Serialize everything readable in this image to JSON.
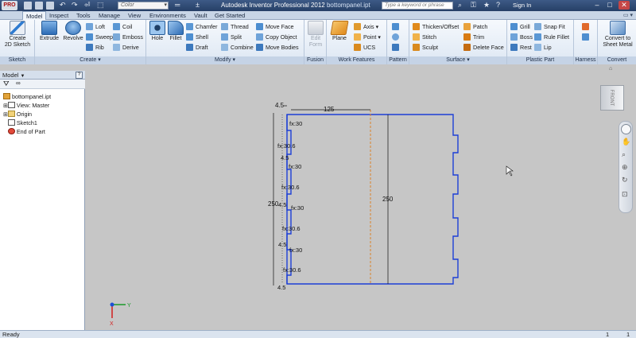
{
  "title_bar": {
    "app_button": "PRO",
    "color_combo": "Color",
    "app_name": "Autodesk Inventor Professional 2012",
    "document": "bottompanel.ipt",
    "search_placeholder": "Type a keyword or phrase",
    "sign_in": "Sign In"
  },
  "tabs": [
    "Model",
    "Inspect",
    "Tools",
    "Manage",
    "View",
    "Environments",
    "Vault",
    "Get Started"
  ],
  "ribbon": {
    "sketch_panel": {
      "label": "Sketch",
      "create_2d_sketch": "Create\n2D Sketch"
    },
    "create_panel": {
      "label": "Create",
      "extrude": "Extrude",
      "revolve": "Revolve",
      "small": [
        "Loft",
        "Sweep",
        "Rib",
        "Coil",
        "Emboss",
        "Derive"
      ]
    },
    "modify_panel": {
      "label": "Modify",
      "hole": "Hole",
      "fillet": "Fillet",
      "small": [
        "Chamfer",
        "Shell",
        "Draft",
        "Thread",
        "Split",
        "Combine",
        "Move Face",
        "Copy Object",
        "Move Bodies"
      ]
    },
    "fusion_panel": {
      "label": "Fusion",
      "edit_form": "Edit\nForm"
    },
    "work_features_panel": {
      "label": "Work Features",
      "plane": "Plane",
      "small": [
        "Axis",
        "Point",
        "UCS"
      ]
    },
    "pattern_panel": {
      "label": "Pattern"
    },
    "surface_panel": {
      "label": "Surface",
      "small": [
        "Thicken/Offset",
        "Stitch",
        "Sculpt",
        "Patch",
        "Trim",
        "Delete Face"
      ]
    },
    "plastic_part_panel": {
      "label": "Plastic Part",
      "small": [
        "Grill",
        "Boss",
        "Rest",
        "Snap Fit",
        "Rule Fillet",
        "Lip"
      ]
    },
    "harness_panel": {
      "label": "Harness"
    },
    "convert_panel": {
      "label": "Convert",
      "convert_to_sheet_metal": "Convert to\nSheet Metal"
    }
  },
  "browser": {
    "header": "Model",
    "items": [
      {
        "label": "bottompanel.ipt",
        "level": 0
      },
      {
        "label": "View: Master",
        "level": 1
      },
      {
        "label": "Origin",
        "level": 1
      },
      {
        "label": "Sketch1",
        "level": 1
      },
      {
        "label": "End of Part",
        "level": 1
      }
    ]
  },
  "sketch": {
    "dim_top_left": "4.5",
    "dim_top_width": "125",
    "dim_height_left": "250",
    "dim_height_inner": "250",
    "fx_30_label": "fx:30",
    "fx_30_6_label": "fx:30.6",
    "dim_4_5": "4.5",
    "dim_bottom": "4.5"
  },
  "viewcube": {
    "face_label": "FRONT"
  },
  "axis_triad": {
    "x": "X",
    "y": "Y"
  },
  "status_bar": {
    "message": "Ready",
    "count_a": "1",
    "count_b": "1"
  }
}
